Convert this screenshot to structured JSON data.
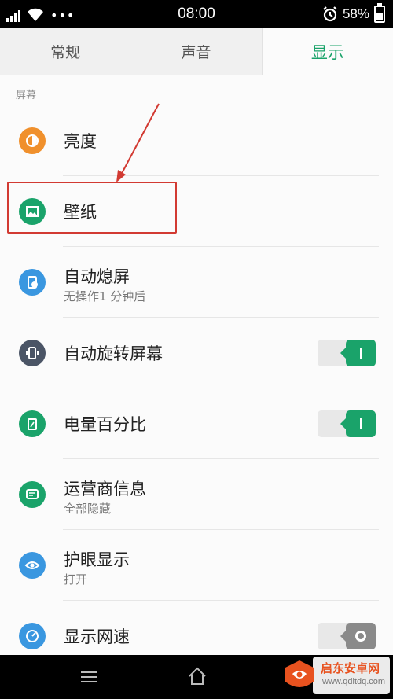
{
  "status_bar": {
    "time": "08:00",
    "battery": "58%",
    "battery_level": 0.58,
    "icons": [
      "signal-icon",
      "wifi-icon",
      "more-dots-icon",
      "alarm-icon",
      "battery-icon"
    ]
  },
  "tabs": [
    {
      "label": "常规",
      "active": false
    },
    {
      "label": "声音",
      "active": false
    },
    {
      "label": "显示",
      "active": true
    }
  ],
  "section": {
    "label": "屏幕"
  },
  "rows": [
    {
      "title": "亮度",
      "icon": "brightness-icon",
      "icon_color": "#f0902c"
    },
    {
      "title": "壁纸",
      "icon": "wallpaper-icon",
      "icon_color": "#1aa36a"
    },
    {
      "title": "自动熄屏",
      "subtitle": "无操作1 分钟后",
      "icon": "screen-timeout-icon",
      "icon_color": "#3a97e0"
    },
    {
      "title": "自动旋转屏幕",
      "icon": "auto-rotate-icon",
      "icon_color": "#4b5566",
      "toggle": true
    },
    {
      "title": "电量百分比",
      "icon": "battery-percent-icon",
      "icon_color": "#1aa36a",
      "toggle": true
    },
    {
      "title": "运营商信息",
      "subtitle": "全部隐藏",
      "icon": "carrier-info-icon",
      "icon_color": "#1aa36a"
    },
    {
      "title": "护眼显示",
      "subtitle": "打开",
      "icon": "eye-care-icon",
      "icon_color": "#3a97e0"
    },
    {
      "title": "显示网速",
      "icon": "network-speed-icon",
      "icon_color": "#3a97e0",
      "toggle": false
    }
  ],
  "colors": {
    "accent": "#1aa36a",
    "annotation": "#d23a32"
  },
  "watermark": {
    "title": "启东安卓网",
    "url": "www.qdltdq.com"
  }
}
